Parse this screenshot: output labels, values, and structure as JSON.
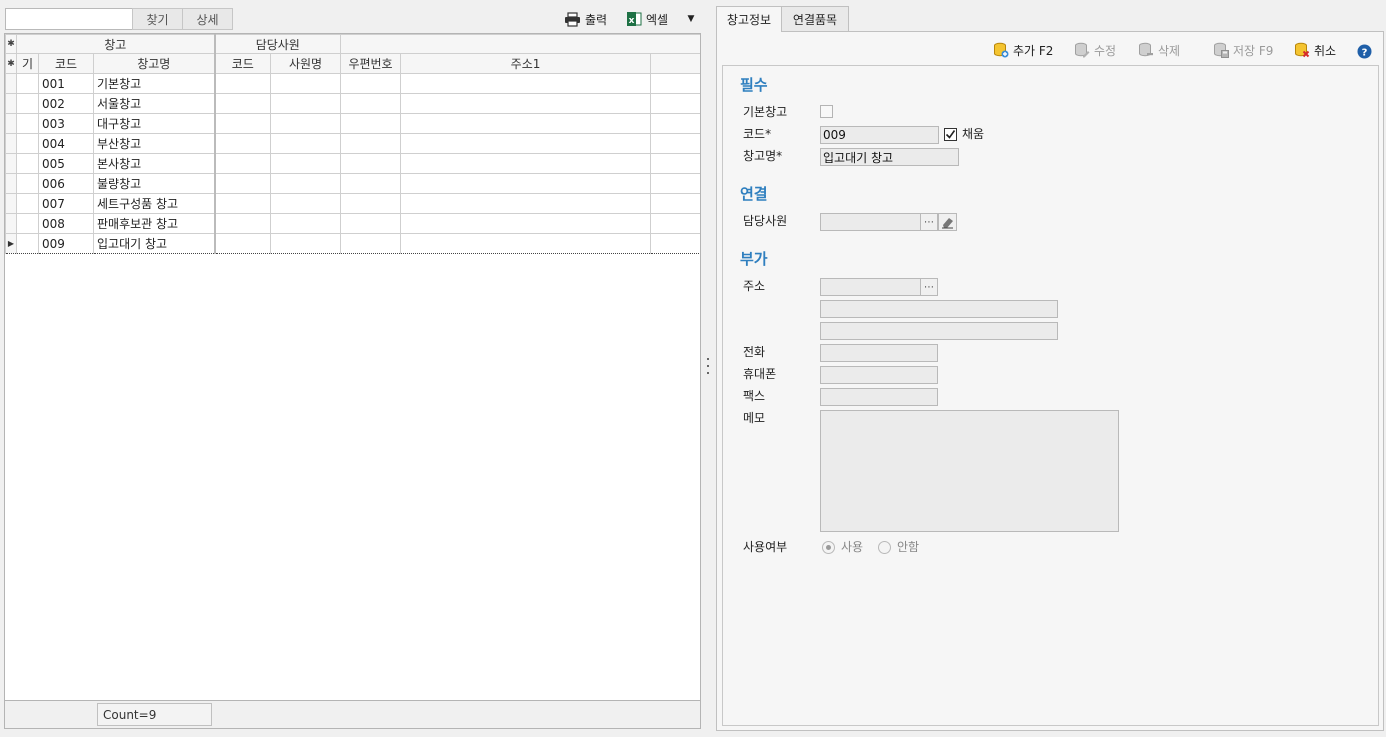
{
  "toolbar": {
    "search_value": "",
    "find_label": "찾기",
    "detail_label": "상세",
    "print_label": "출력",
    "excel_label": "엑셀"
  },
  "grid": {
    "group_headers": {
      "warehouse": "창고",
      "staff": "담당사원"
    },
    "columns": {
      "default": "기",
      "code": "코드",
      "name": "창고명",
      "staff_code": "코드",
      "staff_name": "사원명",
      "zip": "우편번호",
      "address1": "주소1"
    },
    "rows": [
      {
        "code": "001",
        "name": "기본창고"
      },
      {
        "code": "002",
        "name": "서울창고"
      },
      {
        "code": "003",
        "name": "대구창고"
      },
      {
        "code": "004",
        "name": "부산창고"
      },
      {
        "code": "005",
        "name": "본사창고"
      },
      {
        "code": "006",
        "name": "불량창고"
      },
      {
        "code": "007",
        "name": "세트구성품 창고"
      },
      {
        "code": "008",
        "name": "판매후보관 창고"
      },
      {
        "code": "009",
        "name": "입고대기 창고"
      }
    ],
    "count_label": "Count=9"
  },
  "tabs": {
    "info": "창고정보",
    "items": "연결품목"
  },
  "actions": {
    "add": "추가 F2",
    "edit": "수정",
    "delete": "삭제",
    "save": "저장 F9",
    "cancel": "취소"
  },
  "form": {
    "sections": {
      "required": "필수",
      "link": "연결",
      "extra": "부가"
    },
    "labels": {
      "default_wh": "기본창고",
      "code": "코드*",
      "name": "창고명*",
      "auto_fill": "채움",
      "staff": "담당사원",
      "address": "주소",
      "phone": "전화",
      "mobile": "휴대폰",
      "fax": "팩스",
      "memo": "메모",
      "use_status": "사용여부",
      "use": "사용",
      "not_use": "안함"
    },
    "values": {
      "code": "009",
      "name": "입고대기 창고"
    }
  },
  "colors": {
    "section_title": "#2f7fbf",
    "excel_green": "#1e7145",
    "help_blue": "#1f5fa8"
  }
}
